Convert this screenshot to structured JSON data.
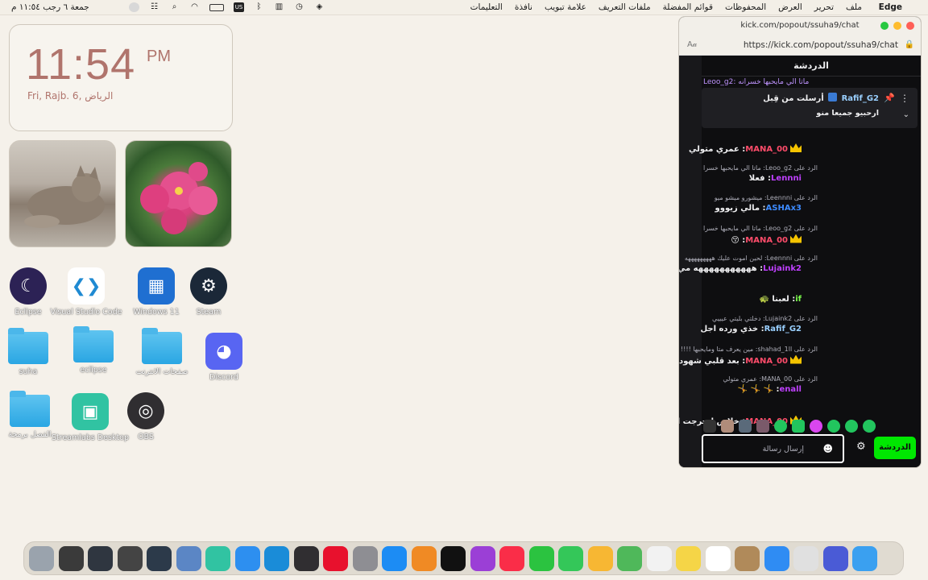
{
  "menubar": {
    "apple": "",
    "app_name": "Edge",
    "menus": [
      "ملف",
      "تحرير",
      "العرض",
      "المحفوظات",
      "قوائم المفضلة",
      "ملفات التعريف",
      "علامة تبويب",
      "نافذة",
      "التعليمات"
    ],
    "clock": "جمعة ٦ رجب  ١١:٥٤ م",
    "status_icons": [
      "control-center-icon",
      "search-icon",
      "screen-recording-icon",
      "battery-icon",
      "wifi-icon",
      "input-source-icon",
      "bluetooth-icon",
      "stats-icon",
      "time-machine-icon",
      "vpn-icon"
    ]
  },
  "clock_widget": {
    "time": "11:54",
    "ampm": "PM",
    "date": "Fri, Rajb. 6,  الرياض"
  },
  "desktop_icons": [
    {
      "name": "eclipse-app",
      "label": "Eclipse",
      "color": "#2c2255"
    },
    {
      "name": "vscode-app",
      "label": "Visual Studio Code",
      "color": "#ffffff"
    },
    {
      "name": "windows11-app",
      "label": "Windows 11",
      "color": "#1f6fd1"
    },
    {
      "name": "steam-app",
      "label": "Steam",
      "color": "#1b2838"
    },
    {
      "name": "folder-suha",
      "label": "suha",
      "color": "#2aa6e3"
    },
    {
      "name": "folder-eclipse",
      "label": "eclipse",
      "color": "#2aa6e3"
    },
    {
      "name": "folder-screenshots",
      "label": "صفحات الانترنت",
      "color": "#2aa6e3"
    },
    {
      "name": "discord-app",
      "label": "Discord",
      "color": "#5865f2"
    },
    {
      "name": "folder-programming",
      "label": "الفصل برمجة",
      "color": "#2aa6e3"
    },
    {
      "name": "streamlabs-app",
      "label": "Streamlabs Desktop",
      "color": "#31c3a2"
    },
    {
      "name": "obs-app",
      "label": "OBS",
      "color": "#302e31"
    }
  ],
  "browser": {
    "title": "kick.com/popout/ssuha9/chat",
    "url": "https://kick.com/popout/ssuha9/chat",
    "chat": {
      "header": "الدردشة",
      "top_cut": "Leoo_g2: ماتا الي مايحبها خسرانه",
      "pinned": {
        "user": "Rafif_G2",
        "prefix": "أرسلت من قِبل",
        "text": "ارحبيو جميعا منو"
      },
      "messages": [
        {
          "reply": "",
          "user": "MANA_00",
          "text": "عمري متولي",
          "color": "#ff4c6a",
          "crown": true
        },
        {
          "reply": "الرد على Leoo_g2: ماتا الي مايحبها خسرا",
          "user": "Lennni",
          "text": "فعلا",
          "color": "#bf40ff",
          "crown": false
        },
        {
          "reply": "الرد على Leennni: ميشورو ميشو ميو",
          "user": "ASHAx3",
          "text": "مالي زيووو",
          "color": "#3d8bff",
          "crown": false
        },
        {
          "reply": "الرد على Leoo_g2: ماتا الي مايحبها خسرا",
          "user": "MANA_00",
          "text": "😚",
          "color": "#ff4c6a",
          "crown": true
        },
        {
          "reply": "الرد على Leennni: لحين اموت عليك هههههههههه",
          "user": "Lujaink2",
          "text": "هههههههههههه مي تو حبي",
          "color": "#bf40ff",
          "crown": false
        },
        {
          "reply": "",
          "user": "if",
          "text": "لعبنا 🐢",
          "color": "#7cff4c",
          "crown": false
        },
        {
          "reply": "الرد على Lujaink2: دخلتي بليتي عيييي",
          "user": "Rafif_G2",
          "text": "خذي ورده اجل",
          "color": "#9ad0ff",
          "crown": false
        },
        {
          "reply": "الرد على shahad_1ll: مين يعرف متا ومايحبها !!!!",
          "user": "MANA_00",
          "text": "بعد قلبي شهود 😄",
          "color": "#ff4c6a",
          "crown": true
        },
        {
          "reply": "الرد على MANA_00: عمري متولي",
          "user": "enall",
          "text": "🤸 🤸 🤸",
          "color": "#bf40ff",
          "crown": false
        },
        {
          "reply": "",
          "user": "MANA_00",
          "text": "خلاص انحرجت انا 😂😂",
          "color": "#ff4c6a",
          "crown": true
        }
      ],
      "input_placeholder": "إرسال رسالة",
      "chat_button": "الدردشة"
    }
  },
  "dock_items": [
    {
      "name": "trash-icon",
      "color": "#9aa3ad"
    },
    {
      "name": "window-thumb-1",
      "color": "#3a3a3a"
    },
    {
      "name": "window-thumb-2",
      "color": "#2f3640"
    },
    {
      "name": "window-thumb-3",
      "color": "#444"
    },
    {
      "name": "window-thumb-4",
      "color": "#2c3a4a"
    },
    {
      "name": "preview-icon",
      "color": "#5b86c5"
    },
    {
      "name": "streamlabs-icon",
      "color": "#31c3a2"
    },
    {
      "name": "safari-icon",
      "color": "#2d8ff0"
    },
    {
      "name": "edge-icon",
      "color": "#1a8cd8"
    },
    {
      "name": "obs-icon",
      "color": "#302e31"
    },
    {
      "name": "opera-icon",
      "color": "#e8112d"
    },
    {
      "name": "system-settings-icon",
      "color": "#8e8e93"
    },
    {
      "name": "app-store-icon",
      "color": "#1c8cf4"
    },
    {
      "name": "books-icon",
      "color": "#f08a24"
    },
    {
      "name": "apple-tv-icon",
      "color": "#111"
    },
    {
      "name": "podcasts-icon",
      "color": "#9b3fd6"
    },
    {
      "name": "music-icon",
      "color": "#fa2d48"
    },
    {
      "name": "facetime-icon",
      "color": "#2bc340"
    },
    {
      "name": "messages-icon",
      "color": "#34c759"
    },
    {
      "name": "photos-icon",
      "color": "#f7b733"
    },
    {
      "name": "maps-icon",
      "color": "#4fb85a"
    },
    {
      "name": "reminders-icon",
      "color": "#f2f2f2"
    },
    {
      "name": "notes-icon",
      "color": "#f5d547"
    },
    {
      "name": "calendar-icon",
      "color": "#ffffff"
    },
    {
      "name": "contacts-icon",
      "color": "#b08a5a"
    },
    {
      "name": "mail-icon",
      "color": "#2f8cf3"
    },
    {
      "name": "launchpad-icon",
      "color": "#e0e0e0"
    },
    {
      "name": "siri-icon",
      "color": "#4a5bd6"
    },
    {
      "name": "finder-icon",
      "color": "#3aa0f0"
    }
  ]
}
